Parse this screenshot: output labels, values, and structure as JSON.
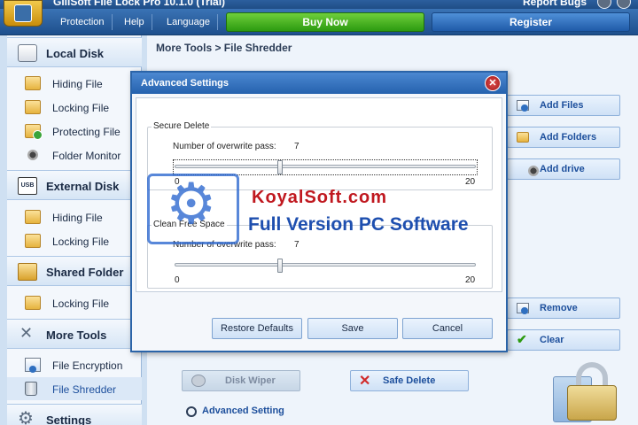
{
  "window": {
    "title": "GiliSoft File Lock Pro 10.1.0 (Trial)",
    "report_bugs": "Report Bugs"
  },
  "menu": {
    "protection": "Protection",
    "help": "Help",
    "language": "Language"
  },
  "actions": {
    "buy_now": "Buy Now",
    "register": "Register"
  },
  "sidebar": {
    "local_disk": {
      "title": "Local Disk",
      "items": [
        "Hiding File",
        "Locking File",
        "Protecting File",
        "Folder Monitor"
      ]
    },
    "external_disk": {
      "title": "External Disk",
      "usb_label": "USB",
      "items": [
        "Hiding File",
        "Locking File"
      ]
    },
    "shared_folder": {
      "title": "Shared Folder",
      "items": [
        "Locking File"
      ]
    },
    "more_tools": {
      "title": "More Tools",
      "items": [
        "File Encryption",
        "File Shredder"
      ]
    },
    "settings": {
      "title": "Settings"
    }
  },
  "main": {
    "breadcrumb": "More Tools > File Shredder",
    "add_files": "Add Files",
    "add_folders": "Add Folders",
    "add_drive": "Add drive",
    "remove": "Remove",
    "clear": "Clear",
    "disk_wiper": "Disk Wiper",
    "safe_delete": "Safe Delete",
    "advanced_setting": "Advanced Setting"
  },
  "dialog": {
    "title": "Advanced Settings",
    "secure_delete": {
      "group": "Secure Delete",
      "label": "Number of overwrite pass:",
      "value": "7",
      "min": "0",
      "max": "20"
    },
    "clean_free_space": {
      "group": "Clean Free Space",
      "label": "Number of overwrite pass:",
      "value": "7",
      "min": "0",
      "max": "20"
    },
    "restore_defaults": "Restore Defaults",
    "save": "Save",
    "cancel": "Cancel"
  },
  "watermark": {
    "brand": "KoyalSoft.com",
    "tagline": "Full Version PC Software"
  },
  "colors": {
    "accent": "#2562ae",
    "buy": "#2c9a10",
    "danger": "#d02a2a"
  }
}
